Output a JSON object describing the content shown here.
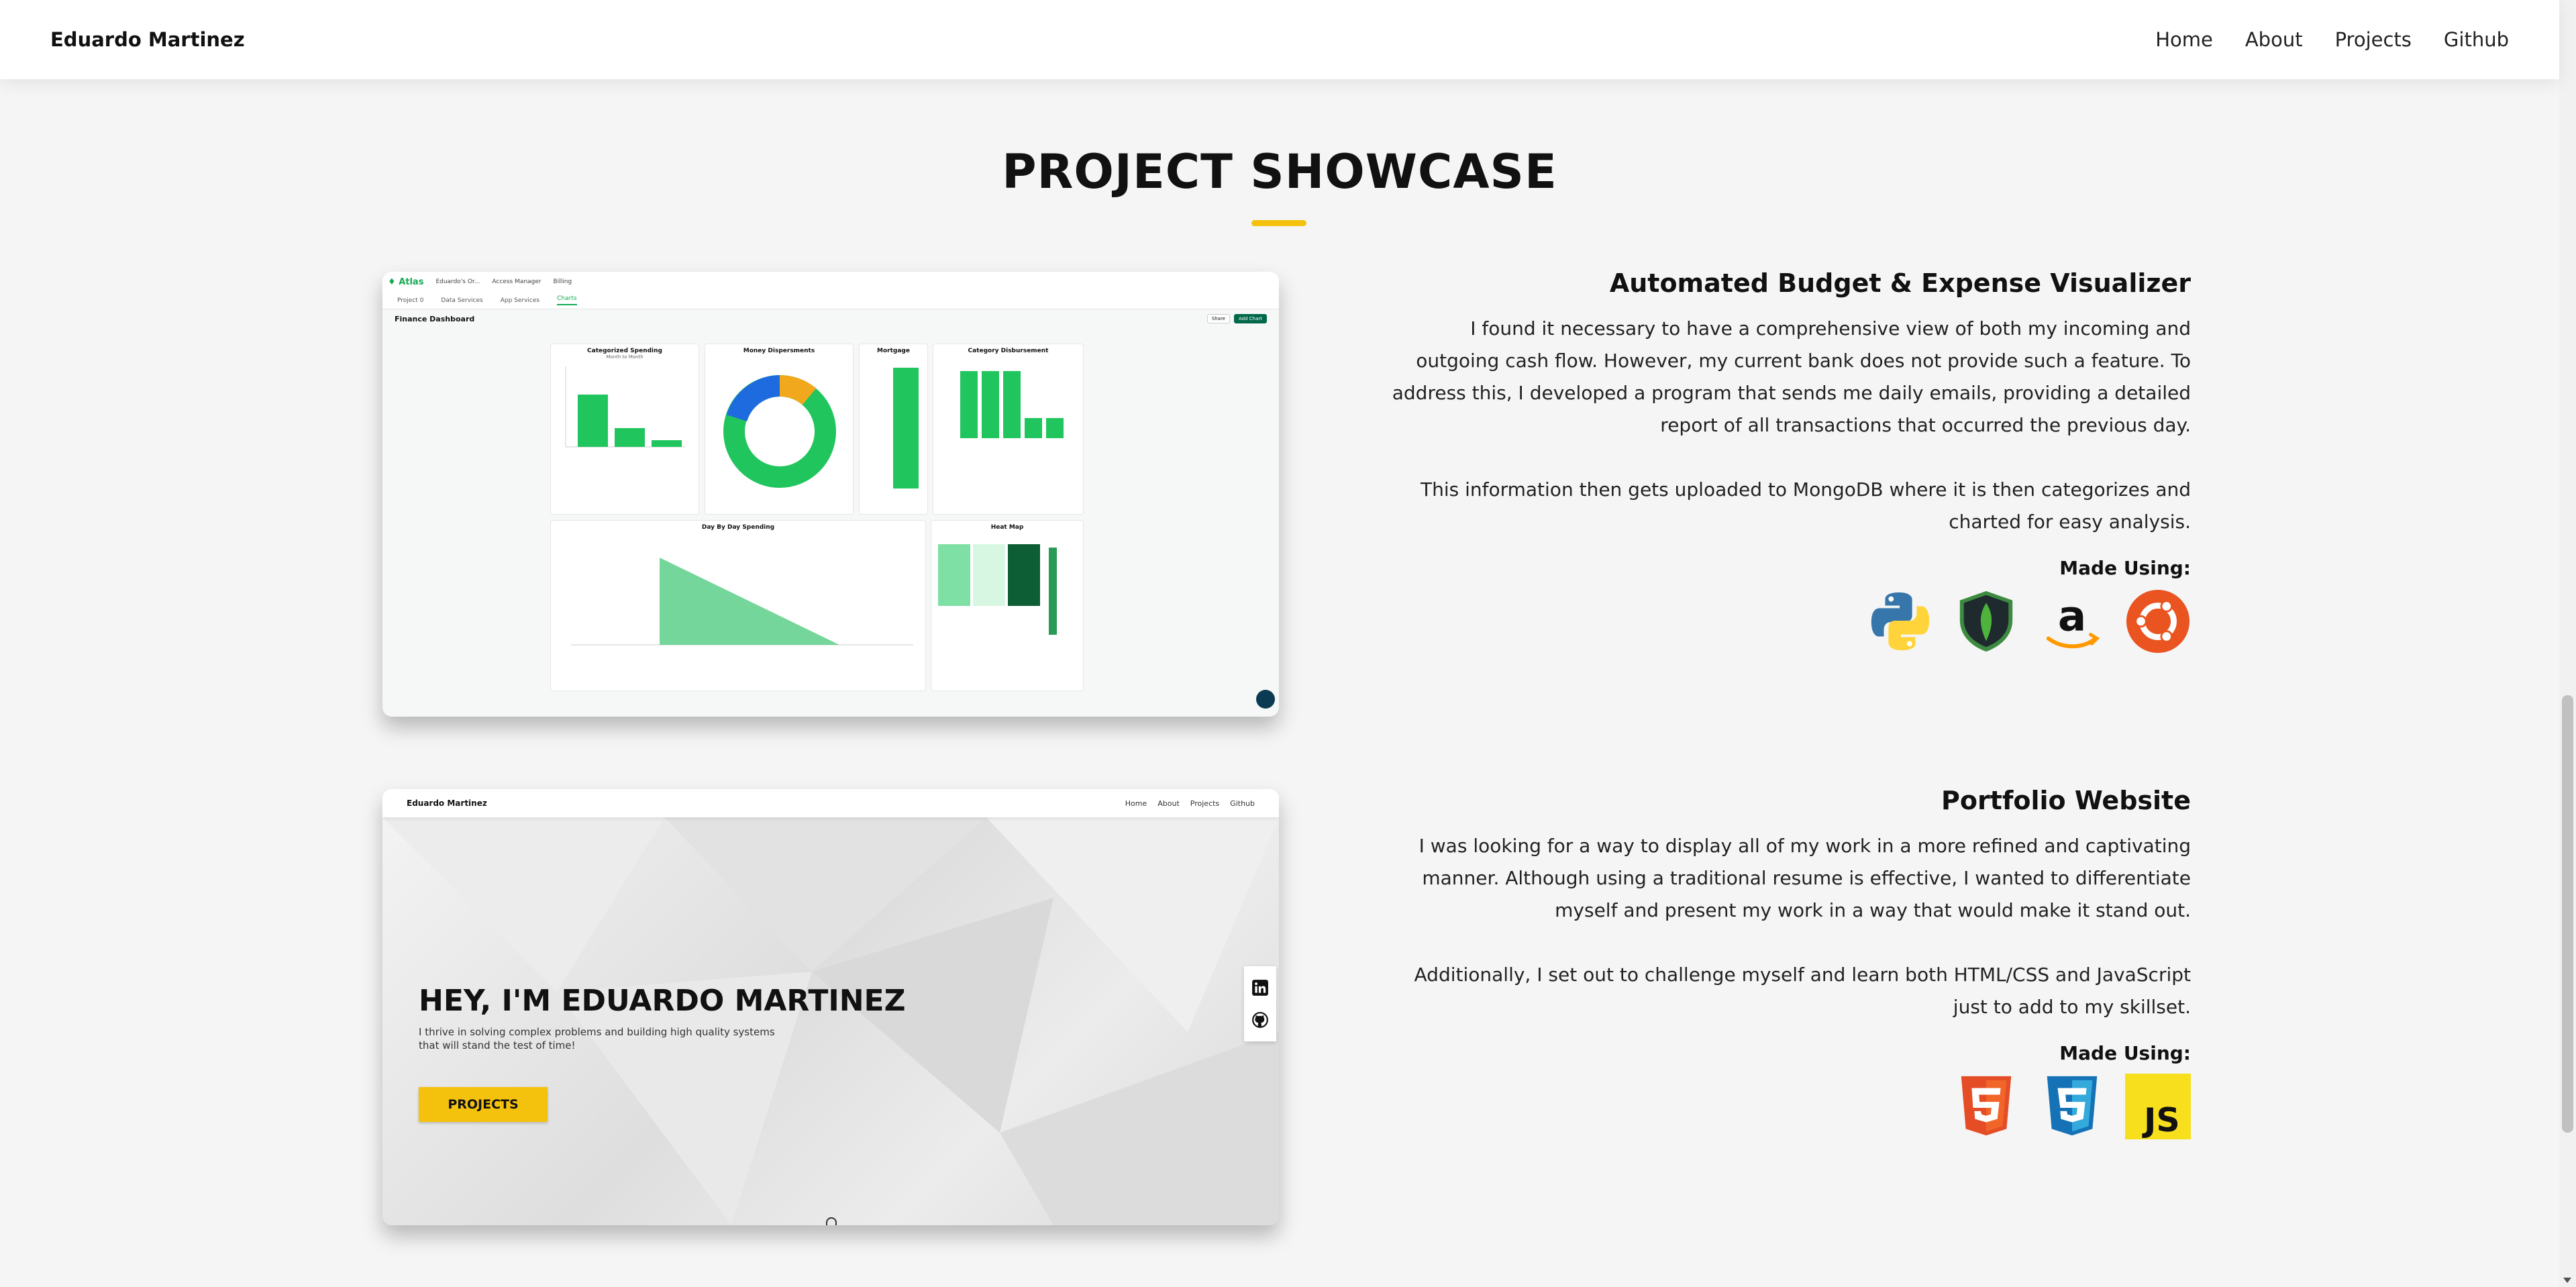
{
  "header": {
    "brand": "Eduardo Martinez",
    "nav": [
      "Home",
      "About",
      "Projects",
      "Github"
    ]
  },
  "section": {
    "title": "PROJECT SHOWCASE",
    "accent_color": "#f4c20d"
  },
  "projects": [
    {
      "title": "Automated Budget & Expense Visualizer",
      "description": [
        "I found it necessary to have a comprehensive view of both my incoming and outgoing cash flow. However, my current bank does not provide such a feature. To address this, I developed a program that sends me daily emails, providing a detailed report of all transactions that occurred the previous day.",
        "This information then gets uploaded to MongoDB where it is then categorizes and charted for easy analysis."
      ],
      "made_using_label": "Made Using:",
      "tech_icons": [
        "python-icon",
        "mongodb-icon",
        "amazon-icon",
        "ubuntu-icon"
      ],
      "screenshot": {
        "app": "Atlas",
        "project_crumb": "Eduardo's Or...",
        "access_manager": "Access Manager",
        "billing": "Billing",
        "project_selector": "Project 0",
        "tabs": [
          "Data Services",
          "App Services",
          "Charts"
        ],
        "active_tab": "Charts",
        "dashboard_title": "Finance Dashboard",
        "actions": [
          "Share",
          "Add Chart"
        ],
        "panels": [
          {
            "title": "Categorized Spending",
            "subtitle": "Month to Month"
          },
          {
            "title": "Money Dispersments"
          },
          {
            "title": "Mortgage"
          },
          {
            "title": "Category Disbursement"
          },
          {
            "title": "Day By Day Spending"
          },
          {
            "title": "Heat Map"
          }
        ]
      }
    },
    {
      "title": "Portfolio Website",
      "description": [
        "I was looking for a way to display all of my work in a more refined and captivating manner. Although using a traditional resume is effective, I wanted to differentiate myself and present my work in a way that would make it stand out.",
        "Additionally, I set out to challenge myself and learn both HTML/CSS and JavaScript just to add to my skillset."
      ],
      "made_using_label": "Made Using:",
      "tech_icons": [
        "html5-icon",
        "css3-icon",
        "javascript-icon"
      ],
      "screenshot": {
        "brand": "Eduardo Martinez",
        "nav": [
          "Home",
          "About",
          "Projects",
          "Github"
        ],
        "hero_title": "HEY, I'M EDUARDO MARTINEZ",
        "hero_subtitle": "I thrive in solving complex problems and building high quality systems that will stand the test of time!",
        "hero_button": "PROJECTS"
      }
    }
  ]
}
